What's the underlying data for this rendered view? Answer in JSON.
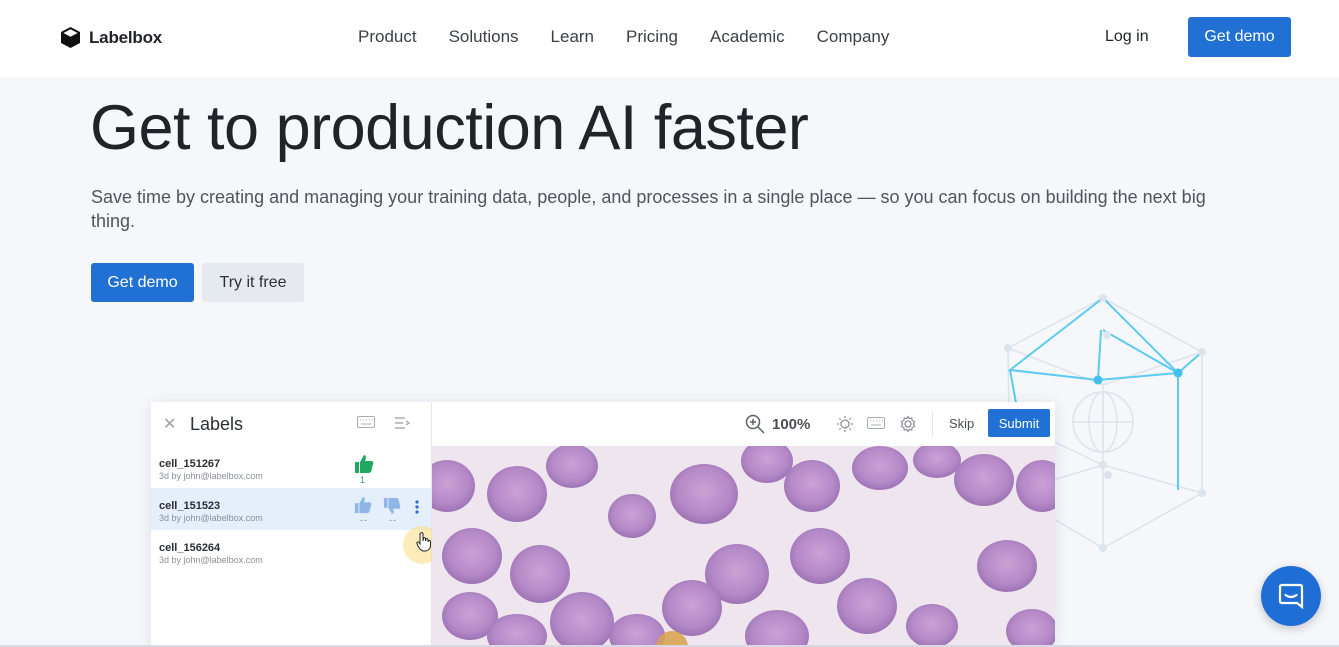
{
  "brand": {
    "name": "Labelbox"
  },
  "nav": {
    "items": [
      "Product",
      "Solutions",
      "Learn",
      "Pricing",
      "Academic",
      "Company"
    ],
    "login": "Log in",
    "cta": "Get demo"
  },
  "hero": {
    "title": "Get to production AI faster",
    "subtitle": "Save time by creating and managing your training data, people, and processes in a single place — so you can focus on building the next big thing.",
    "primary_cta": "Get demo",
    "secondary_cta": "Try it free"
  },
  "app": {
    "panel_title": "Labels",
    "labels": [
      {
        "name": "cell_151267",
        "meta": "3d by john@labelbox.com",
        "approve_count": "1"
      },
      {
        "name": "cell_151523",
        "meta": "3d by john@labelbox.com",
        "approve_count": "--",
        "reject_count": "--"
      },
      {
        "name": "cell_156264",
        "meta": "3d by john@labelbox.com"
      }
    ],
    "zoom": "100%",
    "skip": "Skip",
    "submit": "Submit"
  },
  "colors": {
    "primary": "#2170d4",
    "approve": "#1fa85f",
    "selected_row": "#e5eefb",
    "cell": "#b98ccb"
  },
  "icons": {
    "logo": "labelbox-cube-icon",
    "close": "close-icon",
    "keyboard": "keyboard-icon",
    "menu": "menu-lines-icon",
    "thumb_up": "thumbs-up-icon",
    "thumb_down": "thumbs-down-icon",
    "more": "kebab-icon",
    "zoom": "zoom-in-icon",
    "brightness": "brightness-icon",
    "settings": "gear-icon",
    "chat": "chat-icon"
  }
}
